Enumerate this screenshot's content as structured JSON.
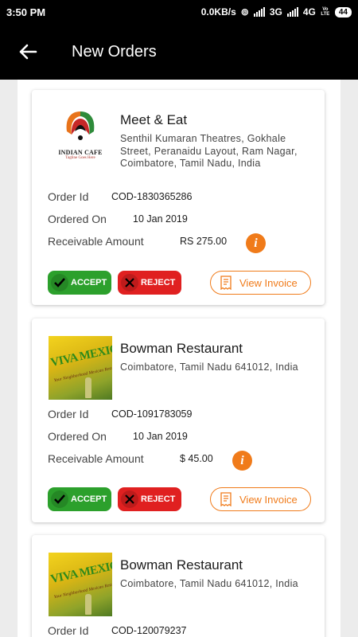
{
  "status_bar": {
    "time": "3:50 PM",
    "network_speed": "0.0KB/s",
    "net1": "3G",
    "net2": "4G",
    "volte": "Vo LTE",
    "battery": "44"
  },
  "header": {
    "title": "New Orders",
    "back_icon": "arrow-left-icon"
  },
  "labels": {
    "order_id": "Order Id",
    "ordered_on": "Ordered On",
    "receivable_amount": "Receivable Amount",
    "accept": "ACCEPT",
    "reject": "REJECT",
    "view_invoice": "View Invoice"
  },
  "orders": [
    {
      "restaurant": "Meet & Eat",
      "address": "Senthil Kumaran Theatres, Gokhale Street, Peranaidu Layout, Ram Nagar, Coimbatore, Tamil Nadu, India",
      "logo": {
        "name": "INDIAN CAFE",
        "tagline": "Tagline Goes Here"
      },
      "order_id": "COD-1830365286",
      "ordered_on": "10 Jan 2019",
      "amount": "RS 275.00"
    },
    {
      "restaurant": "Bowman Restaurant",
      "address": "Coimbatore, Tamil Nadu 641012, India",
      "logo": {
        "name": "VIVA MEXICO",
        "tagline": "Your Neighborhood Mexican Restaurant"
      },
      "order_id": "COD-1091783059",
      "ordered_on": "10 Jan 2019",
      "amount": "$ 45.00"
    },
    {
      "restaurant": "Bowman Restaurant",
      "address": "Coimbatore, Tamil Nadu 641012, India",
      "logo": {
        "name": "VIVA MEXICO",
        "tagline": "Your Neighborhood Mexican Restaurant"
      },
      "order_id": "COD-120079237"
    }
  ],
  "colors": {
    "accept": "#2ca02c",
    "reject": "#e02020",
    "accent": "#f07b1a",
    "appbar": "#000000"
  }
}
